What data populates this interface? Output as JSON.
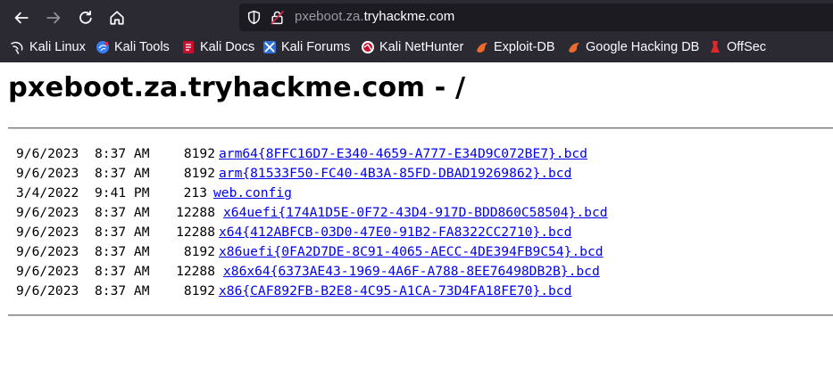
{
  "browser": {
    "url_host": "pxeboot.za.",
    "url_domain": "tryhackme.com",
    "bookmarks": [
      {
        "label": "Kali Linux",
        "icon": "kali-dragon-icon"
      },
      {
        "label": "Kali Tools",
        "icon": "kali-tools-icon"
      },
      {
        "label": "Kali Docs",
        "icon": "kali-docs-icon"
      },
      {
        "label": "Kali Forums",
        "icon": "kali-forums-icon"
      },
      {
        "label": "Kali NetHunter",
        "icon": "nethunter-icon"
      },
      {
        "label": "Exploit-DB",
        "icon": "exploit-db-icon"
      },
      {
        "label": "Google Hacking DB",
        "icon": "ghdb-icon"
      },
      {
        "label": "OffSec",
        "icon": "offsec-icon"
      }
    ]
  },
  "page": {
    "heading": "pxeboot.za.tryhackme.com - /",
    "files": [
      {
        "date": "9/6/2023",
        "time": "8:37 AM",
        "size": "8192",
        "name": "arm64{8FFC16D7-E340-4659-A777-E34D9C072BE7}.bcd"
      },
      {
        "date": "9/6/2023",
        "time": "8:37 AM",
        "size": "8192",
        "name": "arm{81533F50-FC40-4B3A-85FD-DBAD19269862}.bcd"
      },
      {
        "date": "3/4/2022",
        "time": "9:41 PM",
        "size": "213",
        "name": "web.config"
      },
      {
        "date": "9/6/2023",
        "time": "8:37 AM",
        "size": "12288",
        "name": "x64uefi{174A1D5E-0F72-43D4-917D-BDD860C58504}.bcd"
      },
      {
        "date": "9/6/2023",
        "time": "8:37 AM",
        "size": "12288",
        "name": "x64{412ABFCB-03D0-47E0-91B2-FA8322CC2710}.bcd"
      },
      {
        "date": "9/6/2023",
        "time": "8:37 AM",
        "size": "8192",
        "name": "x86uefi{0FA2D7DE-8C91-4065-AECC-4DE394FB9C54}.bcd"
      },
      {
        "date": "9/6/2023",
        "time": "8:37 AM",
        "size": "12288",
        "name": "x86x64{6373AE43-1969-4A6F-A788-8EE76498DB2B}.bcd"
      },
      {
        "date": "9/6/2023",
        "time": "8:37 AM",
        "size": "8192",
        "name": "x86{CAF892FB-B2E8-4C95-A1CA-73D4FA18FE70}.bcd"
      }
    ]
  }
}
